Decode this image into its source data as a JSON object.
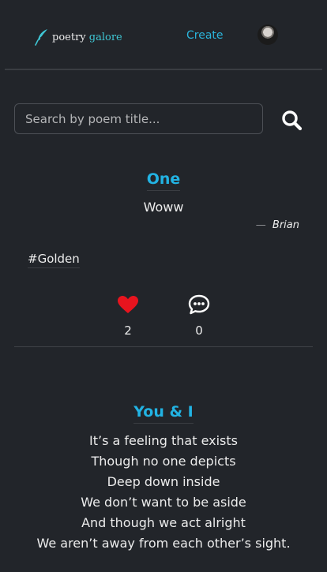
{
  "header": {
    "logo_word_1": "poetry",
    "logo_word_2": "galore",
    "create_label": "Create"
  },
  "search": {
    "placeholder": "Search by poem title...",
    "value": ""
  },
  "poems": [
    {
      "title": "One",
      "body": "Woww",
      "author": "Brian",
      "author_dash": "—",
      "tag": "#Golden",
      "likes": "2",
      "comments": "0"
    },
    {
      "title": "You & I",
      "lines": [
        "It’s a feeling that exists",
        "Though no one depicts",
        "Deep down inside",
        "We don’t want to be aside",
        "And though we act alright",
        "We aren’t away from each other’s sight."
      ]
    }
  ],
  "icons": {
    "logo": "quill-pen-icon",
    "search": "search-icon",
    "like": "heart-icon",
    "comment": "comment-icon"
  },
  "colors": {
    "background": "#22252a",
    "accent": "#22b3e3",
    "heart": "#e8141e",
    "logo_teal": "#3fc6d4"
  }
}
